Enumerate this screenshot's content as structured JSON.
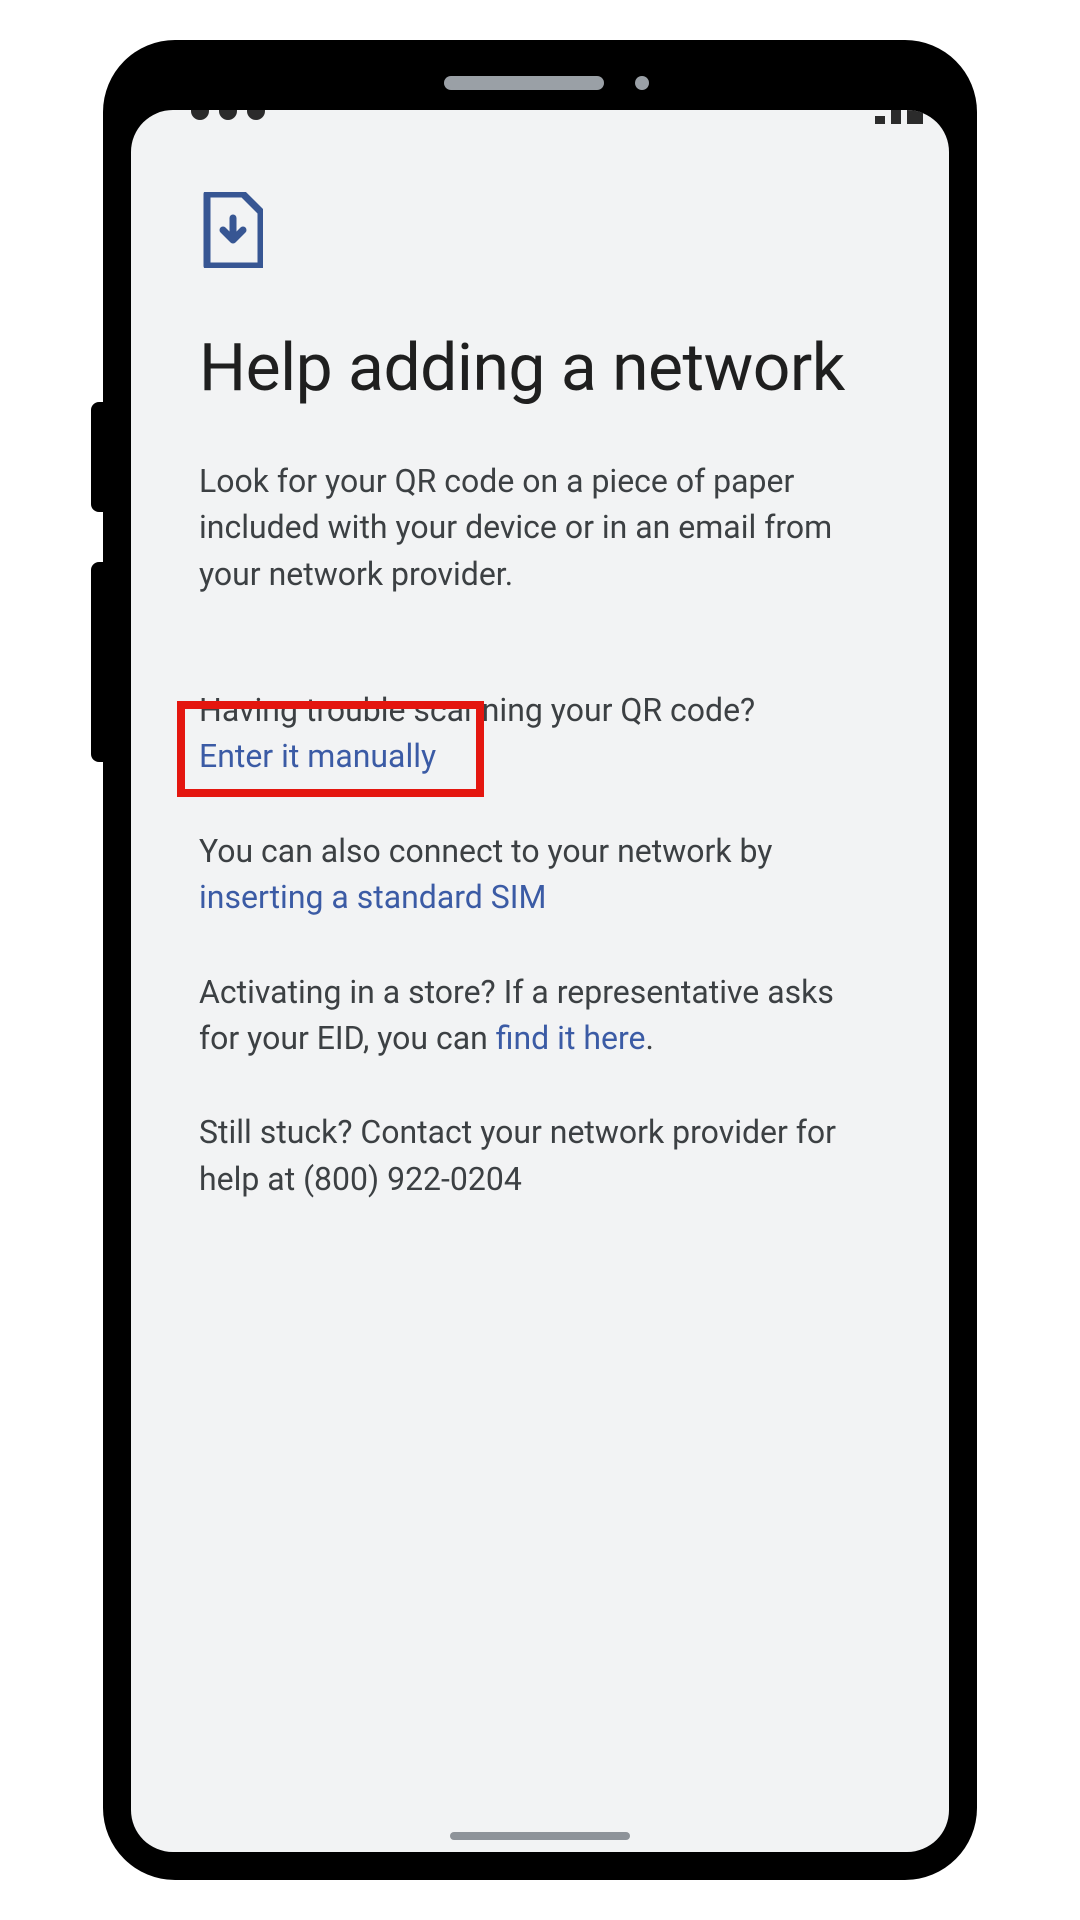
{
  "colors": {
    "link": "#3b5ba5",
    "highlight_border": "#e4160f",
    "screen_bg": "#f2f3f4",
    "text_primary": "#1f1f1f",
    "text_body": "#3c4043"
  },
  "icon": "sim-download-icon",
  "title": "Help adding a network",
  "intro": "Look for your QR code on a piece of paper included with your device or in an email from your network provider.",
  "qr_trouble": {
    "question": "Having trouble scanning your QR code?",
    "link_label": "Enter it manually"
  },
  "standard_sim": {
    "prefix": "You can also connect to your network by ",
    "link_label": "inserting a standard SIM"
  },
  "store": {
    "prefix": "Activating in a store? If a representative asks for your EID, you can ",
    "link_label": "find it here",
    "suffix": "."
  },
  "stuck": {
    "text_prefix": "Still stuck? Contact your network provider for help at ",
    "phone": "(800) 922-0204"
  },
  "annotation": {
    "highlighted_element": "enter-manually-link"
  }
}
